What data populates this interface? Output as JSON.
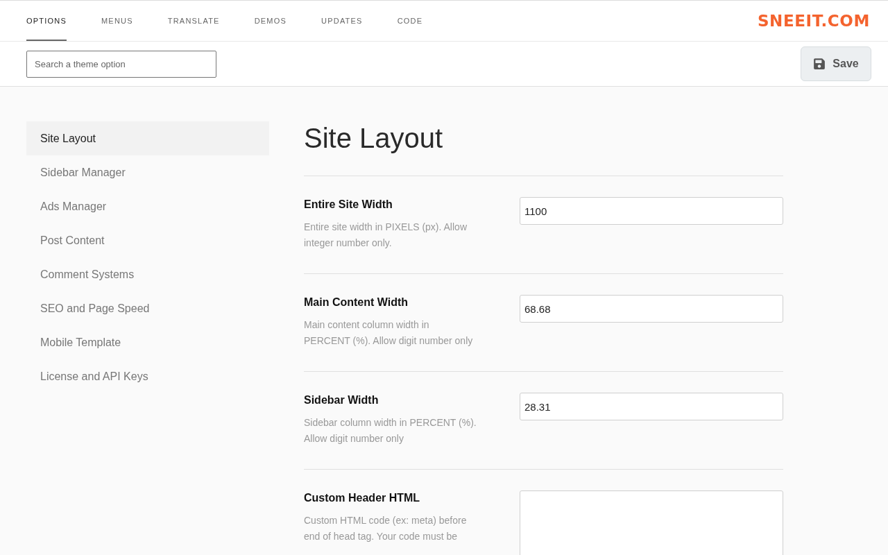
{
  "tabs": [
    {
      "label": "OPTIONS",
      "selected": true
    },
    {
      "label": "MENUS",
      "selected": false
    },
    {
      "label": "TRANSLATE",
      "selected": false
    },
    {
      "label": "DEMOS",
      "selected": false
    },
    {
      "label": "UPDATES",
      "selected": false
    },
    {
      "label": "CODE",
      "selected": false
    }
  ],
  "logo": {
    "text": "SNEEIT.COM"
  },
  "search": {
    "placeholder": "Search a theme option"
  },
  "save_button": {
    "label": "Save"
  },
  "sidebar": {
    "items": [
      {
        "label": "Site Layout",
        "selected": true
      },
      {
        "label": "Sidebar Manager",
        "selected": false
      },
      {
        "label": "Ads Manager",
        "selected": false
      },
      {
        "label": "Post Content",
        "selected": false
      },
      {
        "label": "Comment Systems",
        "selected": false
      },
      {
        "label": "SEO and Page Speed",
        "selected": false
      },
      {
        "label": "Mobile Template",
        "selected": false
      },
      {
        "label": "License and API Keys",
        "selected": false
      }
    ]
  },
  "section": {
    "title": "Site Layout",
    "fields": [
      {
        "kind": "text",
        "label": "Entire Site Width",
        "description": "Entire site width in PIXELS (px). Allow integer number only.",
        "value": "1100"
      },
      {
        "kind": "text",
        "label": "Main Content Width",
        "description": "Main content column width in PERCENT (%). Allow digit number only",
        "value": "68.68"
      },
      {
        "kind": "text",
        "label": "Sidebar Width",
        "description": "Sidebar column width in PERCENT (%). Allow digit number only",
        "value": "28.31"
      },
      {
        "kind": "textarea",
        "label": "Custom Header HTML",
        "description": "Custom HTML code (ex: meta) before end of head tag. Your code must be"
      }
    ]
  }
}
